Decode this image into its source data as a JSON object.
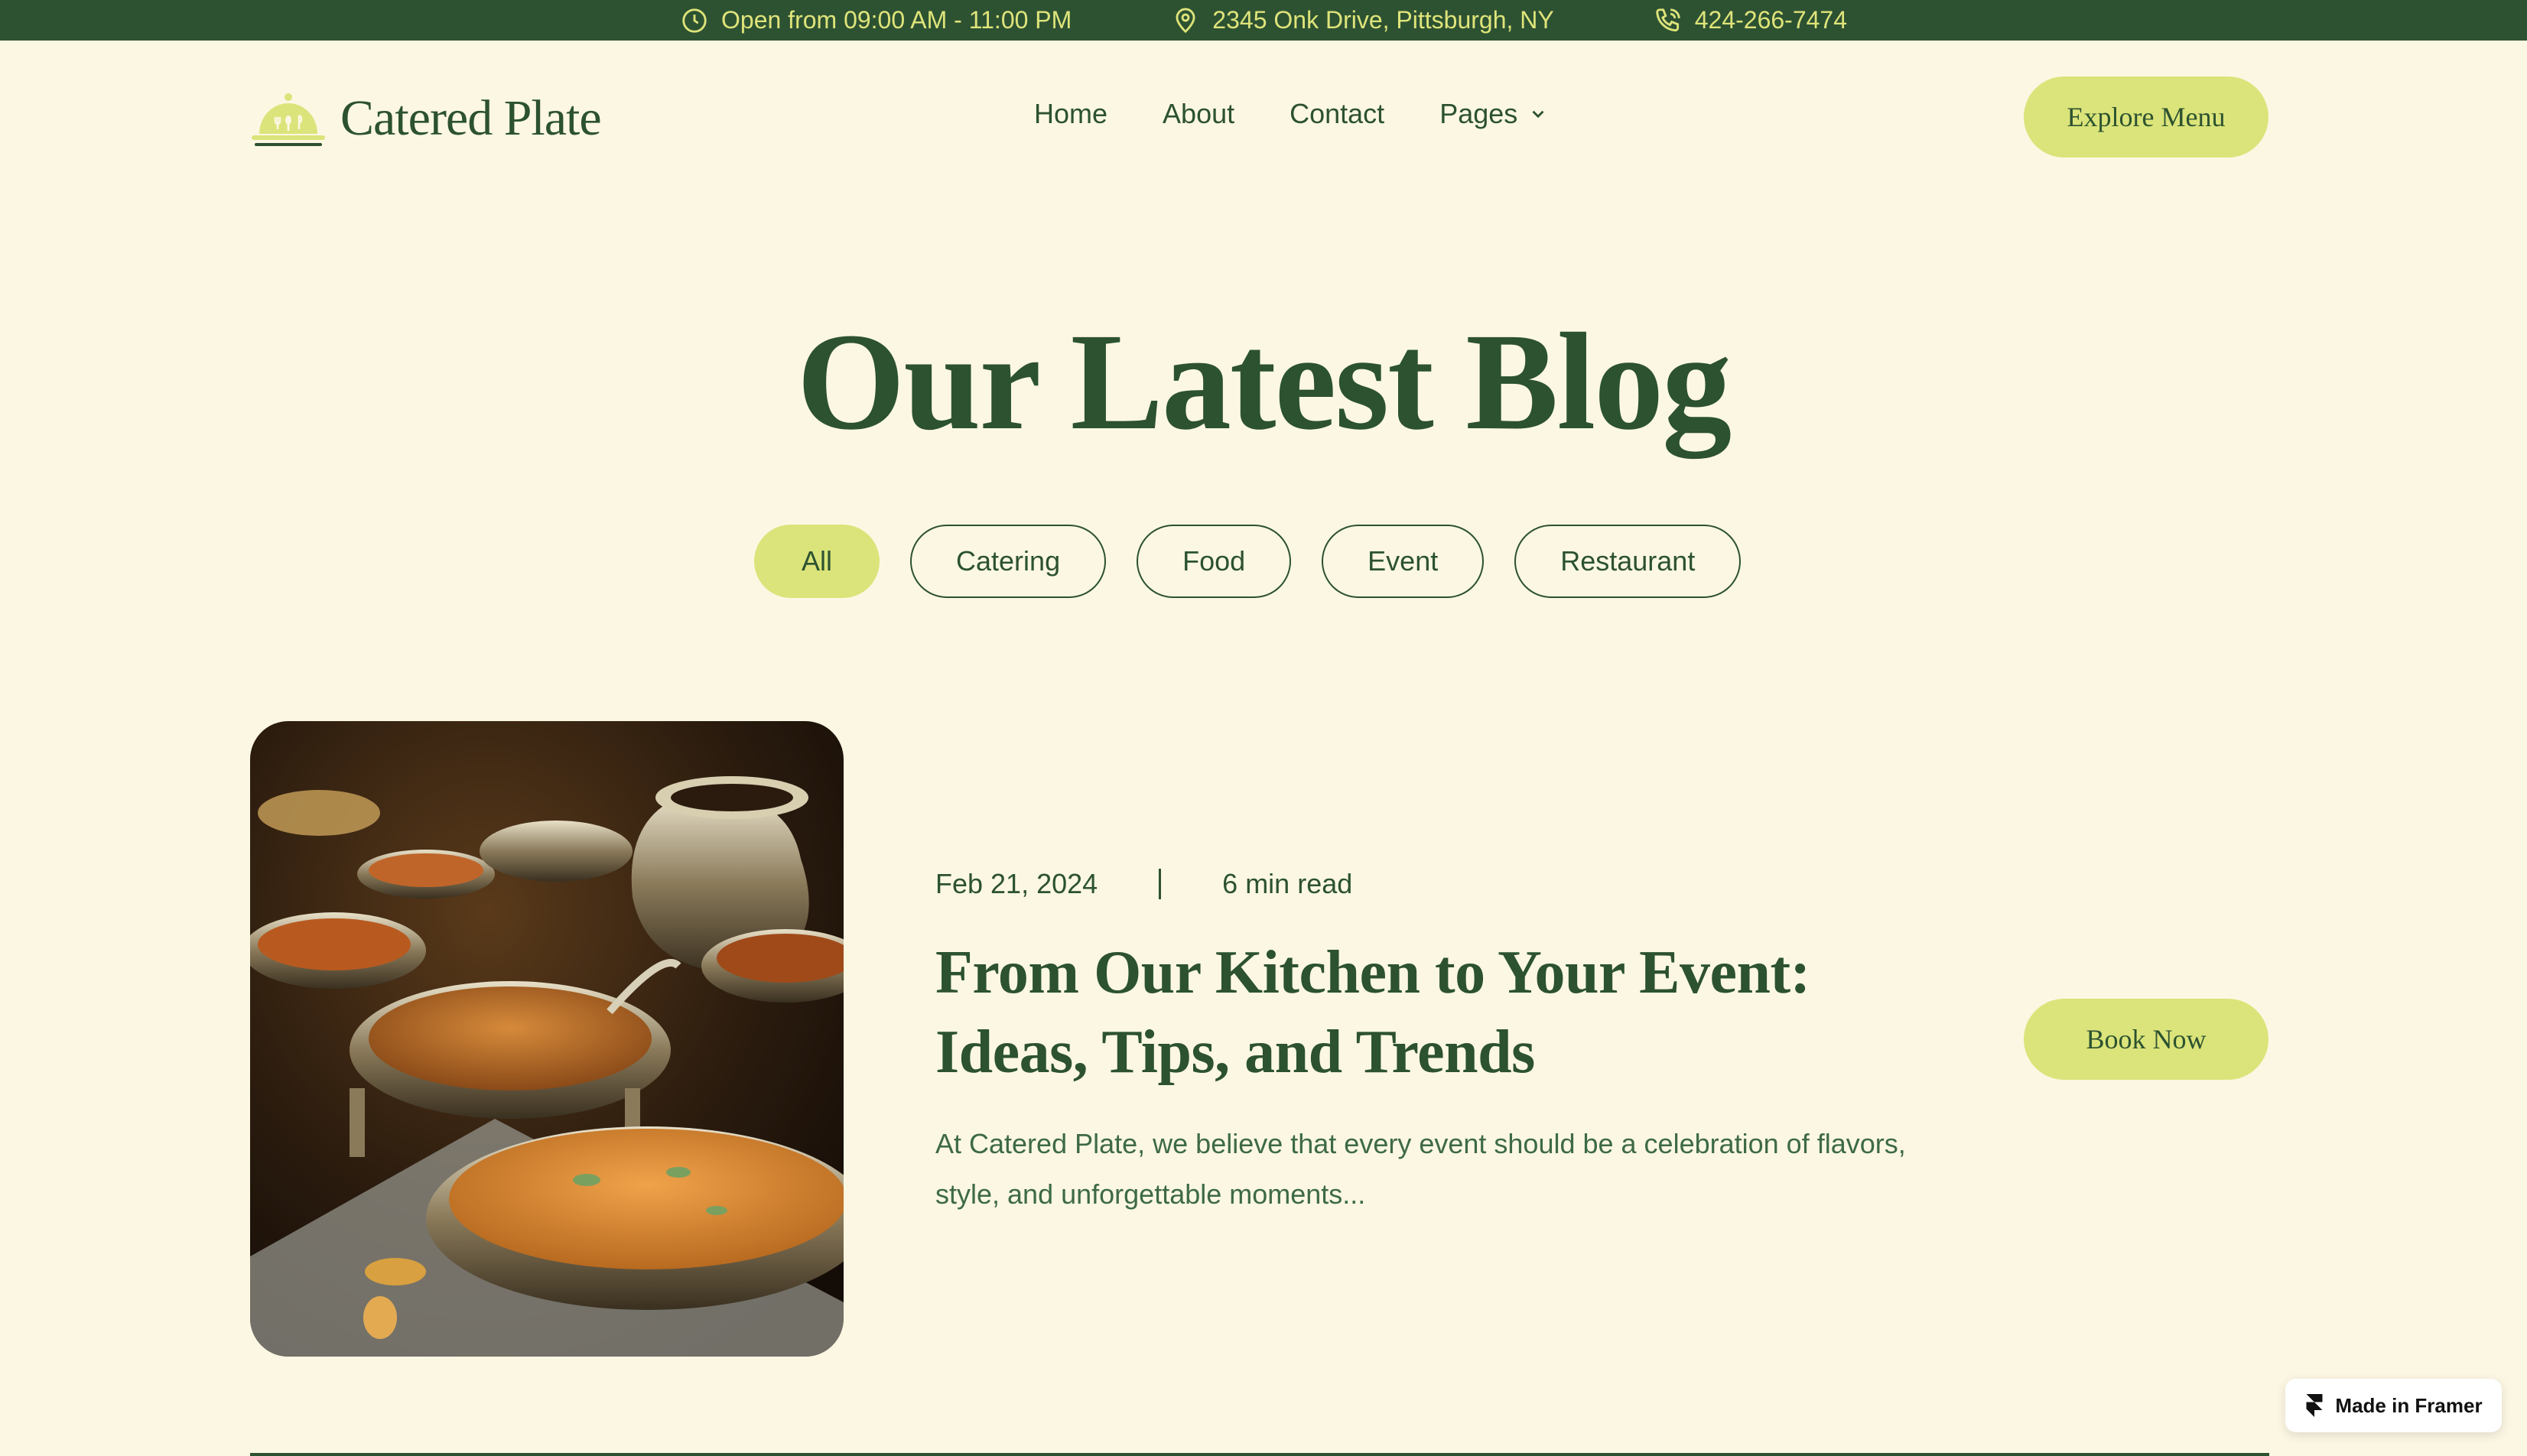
{
  "topbar": {
    "hours": "Open from 09:00 AM - 11:00 PM",
    "address": "2345 Onk Drive, Pittsburgh, NY",
    "phone": "424-266-7474",
    "icons": [
      "clock-icon",
      "map-pin-icon",
      "phone-icon"
    ]
  },
  "header": {
    "brand": "Catered Plate",
    "nav": [
      {
        "label": "Home"
      },
      {
        "label": "About"
      },
      {
        "label": "Contact"
      },
      {
        "label": "Pages"
      }
    ],
    "cta": "Explore Menu"
  },
  "hero": {
    "title": "Our Latest Blog"
  },
  "filters": [
    "All",
    "Catering",
    "Food",
    "Event",
    "Restaurant"
  ],
  "post": {
    "date": "Feb 21, 2024",
    "read_time": "6 min read",
    "title": "From Our Kitchen to Your Event: Ideas, Tips, and Trends",
    "excerpt": "At Catered Plate, we believe that every event should be a celebration of flavors, style, and unforgettable moments...",
    "cta": "Book Now"
  },
  "badge": {
    "label": "Made in Framer"
  },
  "colors": {
    "background": "#fcf7e3",
    "primary": "#2d5232",
    "accent": "#dbe47a"
  }
}
